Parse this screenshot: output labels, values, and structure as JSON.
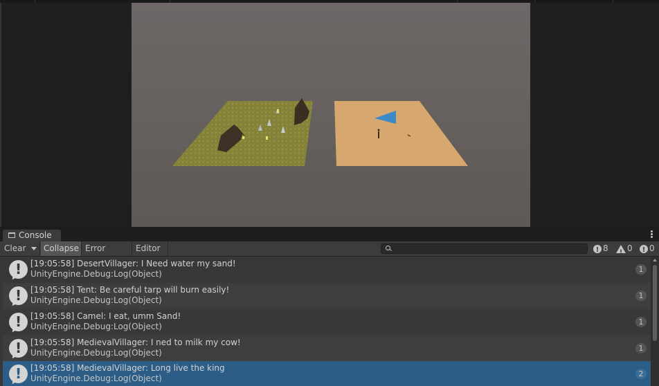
{
  "console": {
    "tab_title": "Console",
    "toolbar": {
      "clear_label": "Clear",
      "collapse_label": "Collapse",
      "error_pause_label": "Error Pause",
      "editor_label": "Editor",
      "search_value": ""
    },
    "counters": {
      "info": "8",
      "warnings": "0",
      "errors": "0"
    },
    "entries": [
      {
        "message": "[19:05:58] DesertVillager: I Need water my sand!",
        "source": "UnityEngine.Debug:Log(Object)",
        "count": "1",
        "selected": false
      },
      {
        "message": "[19:05:58] Tent: Be careful tarp will burn easily!",
        "source": "UnityEngine.Debug:Log(Object)",
        "count": "1",
        "selected": false
      },
      {
        "message": "[19:05:58] Camel: I eat, umm Sand!",
        "source": "UnityEngine.Debug:Log(Object)",
        "count": "1",
        "selected": false
      },
      {
        "message": "[19:05:58] MedievalVillager: I ned to milk my cow!",
        "source": "UnityEngine.Debug:Log(Object)",
        "count": "1",
        "selected": false
      },
      {
        "message": "[19:05:58] MedievalVillager: Long live the king",
        "source": "UnityEngine.Debug:Log(Object)",
        "count": "2",
        "selected": true
      }
    ],
    "entry_icon": "info-bubble-icon"
  },
  "colors": {
    "selected_row": "#2c5d87",
    "grass_plane": "#8a8a3a",
    "sand_plane": "#d7a970",
    "sky": "#6b6565",
    "flag": "#3a86c2"
  }
}
